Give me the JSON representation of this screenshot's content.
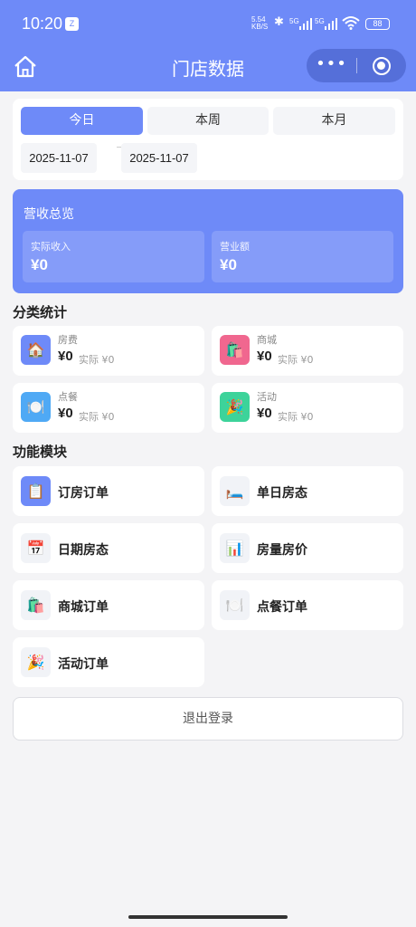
{
  "status_bar": {
    "time": "10:20",
    "notification_icon": "Z",
    "net_speed_value": "5.54",
    "net_speed_unit": "KB/S",
    "signal_1_label": "5G",
    "signal_2_label": "5G",
    "battery": "88"
  },
  "nav": {
    "title": "门店数据",
    "home_icon": "home-icon",
    "more_icon": "•••"
  },
  "date_filter": {
    "tabs": [
      {
        "label": "今日",
        "active": true
      },
      {
        "label": "本周",
        "active": false
      },
      {
        "label": "本月",
        "active": false
      }
    ],
    "start_date": "2025-11-07",
    "end_date": "2025-11-07"
  },
  "revenue": {
    "title": "营收总览",
    "actual_label": "实际收入",
    "actual_value": "¥0",
    "turnover_label": "营业额",
    "turnover_value": "¥0"
  },
  "category": {
    "title": "分类统计",
    "items": [
      {
        "name": "房费",
        "amount": "¥0",
        "actual": "实际 ¥0",
        "icon": "🏠",
        "color": "#6e8af8"
      },
      {
        "name": "商城",
        "amount": "¥0",
        "actual": "实际 ¥0",
        "icon": "🛍️",
        "color": "#f0678f"
      },
      {
        "name": "点餐",
        "amount": "¥0",
        "actual": "实际 ¥0",
        "icon": "🍽️",
        "color": "#4fa9f5"
      },
      {
        "name": "活动",
        "amount": "¥0",
        "actual": "实际 ¥0",
        "icon": "🎉",
        "color": "#3dd39a"
      }
    ]
  },
  "modules": {
    "title": "功能模块",
    "items": [
      {
        "label": "订房订单",
        "icon": "📋"
      },
      {
        "label": "单日房态",
        "icon": "🛏️"
      },
      {
        "label": "日期房态",
        "icon": "📅"
      },
      {
        "label": "房量房价",
        "icon": "📊"
      },
      {
        "label": "商城订单",
        "icon": "🛍️"
      },
      {
        "label": "点餐订单",
        "icon": "🍽️"
      },
      {
        "label": "活动订单",
        "icon": "🎉"
      }
    ]
  },
  "logout_label": "退出登录",
  "colors": {
    "primary": "#6e8af8",
    "background": "#f4f4f6"
  }
}
